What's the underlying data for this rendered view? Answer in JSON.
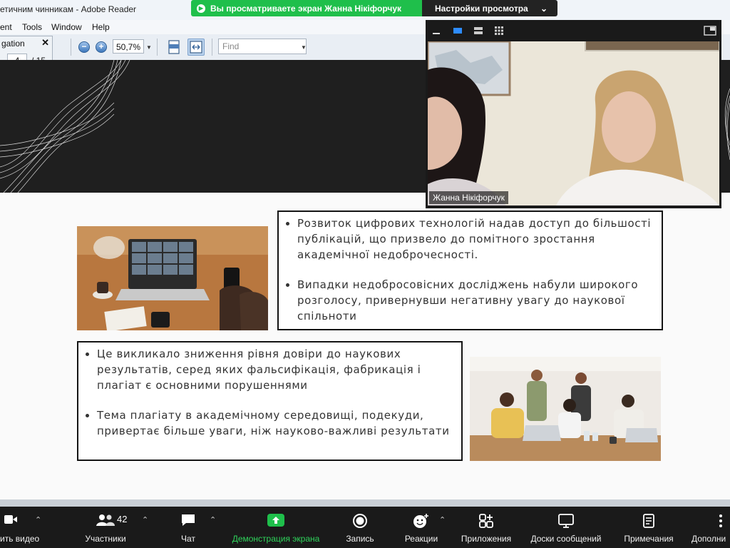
{
  "window": {
    "title": "етичним чинникам - Adobe Reader"
  },
  "menu": {
    "items": [
      "ent",
      "Tools",
      "Window",
      "Help"
    ]
  },
  "toolbar": {
    "zoom": "50,7%",
    "find_placeholder": "Find"
  },
  "navigation": {
    "title": "gation",
    "current_page": "4",
    "total_pages": "/ 15"
  },
  "share_banner": {
    "message": "Вы просматриваете экран Жанна Нікіфорчук",
    "view_options": "Настройки просмотра"
  },
  "slide": {
    "box1": {
      "bullets": [
        "Розвиток цифрових технологій надав доступ до більшості публікацій, що призвело до помітного зростання академічної недоброчесності.",
        "Випадки недобросовісних досліджень набули широкого розголосу, привернувши негативну увагу до наукової спільноти"
      ]
    },
    "box2": {
      "bullets": [
        "Це викликало зниження рівня довіри до наукових результатів, серед яких фальсифікація, фабрикація і плагіат є основними порушеннями",
        "Тема плагіату в академічному середовищі, подекуди, привертає більше уваги, ніж науково-важливі результати"
      ]
    }
  },
  "video": {
    "participant_name": "Жанна Нікіфорчук"
  },
  "zoom_toolbar": {
    "video_label": "ить видео",
    "participants_label": "Участники",
    "participants_count": "42",
    "chat_label": "Чат",
    "share_label": "Демонстрация экрана",
    "record_label": "Запись",
    "reactions_label": "Реакции",
    "apps_label": "Приложения",
    "whiteboards_label": "Доски сообщений",
    "notes_label": "Примечания",
    "more_label": "Дополни"
  },
  "colors": {
    "share_green": "#1fbf4b",
    "zoom_bar": "#1a1a1a",
    "slide_dark": "#1f1f1f"
  }
}
